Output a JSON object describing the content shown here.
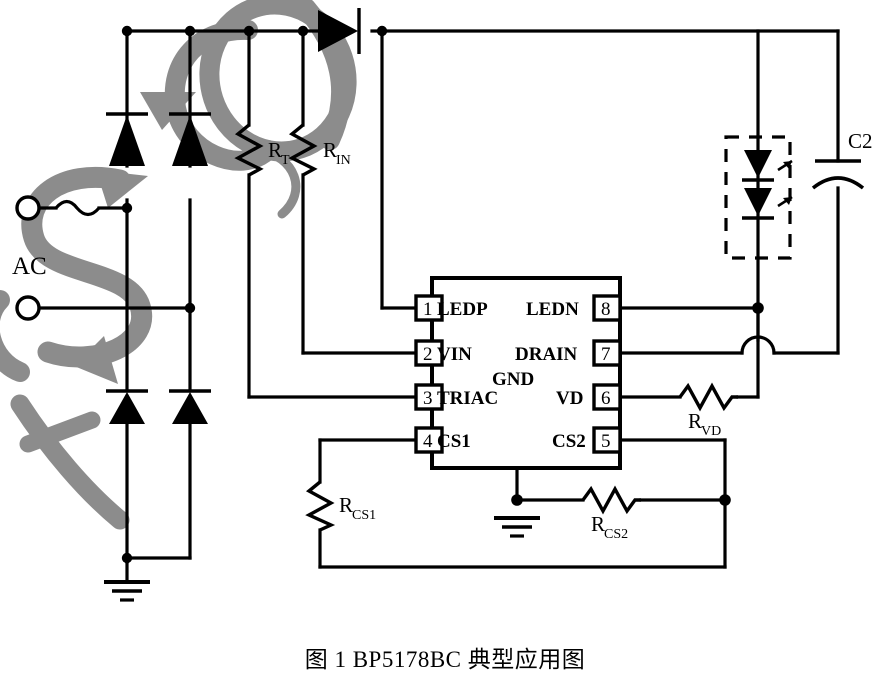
{
  "caption": "图 1  BP5178BC 典型应用图",
  "watermark": {
    "text": "S.COM",
    "color": "#8c8c8c"
  },
  "colors": {
    "wire": "#000000",
    "background": "#ffffff",
    "watermark": "#8c8c8c"
  },
  "source": {
    "label": "AC",
    "terminal_top": "ac-terminal-top",
    "terminal_bottom": "ac-terminal-bottom",
    "fuse": "fuse"
  },
  "ic": {
    "left_pins": [
      {
        "number": "1",
        "name": "LEDP"
      },
      {
        "number": "2",
        "name": "VIN"
      },
      {
        "number": "3",
        "name": "TRIAC"
      },
      {
        "number": "4",
        "name": "CS1"
      }
    ],
    "right_pins": [
      {
        "number": "8",
        "name": "LEDN"
      },
      {
        "number": "7",
        "name": "DRAIN"
      },
      {
        "number": "6",
        "name": "VD"
      },
      {
        "number": "5",
        "name": "CS2"
      }
    ],
    "center_label": "GND"
  },
  "components": {
    "rt": {
      "label": "R",
      "sub": "T"
    },
    "rin": {
      "label": "R",
      "sub": "IN"
    },
    "rvd": {
      "label": "R",
      "sub": "VD"
    },
    "rcs1": {
      "label": "R",
      "sub": "CS1"
    },
    "rcs2": {
      "label": "R",
      "sub": "CS2"
    },
    "c2": {
      "label": "C2"
    }
  },
  "elements": {
    "bridge_diode_1": "bridge-rectifier-diode-upper-left",
    "bridge_diode_2": "bridge-rectifier-diode-upper-right",
    "bridge_diode_3": "bridge-rectifier-diode-lower-left",
    "bridge_diode_4": "bridge-rectifier-diode-lower-right",
    "series_diode": "series-blocking-diode",
    "led_string": "led-load-string",
    "ground_main": "ground-symbol-input",
    "ground_ic": "ground-symbol-ic"
  }
}
